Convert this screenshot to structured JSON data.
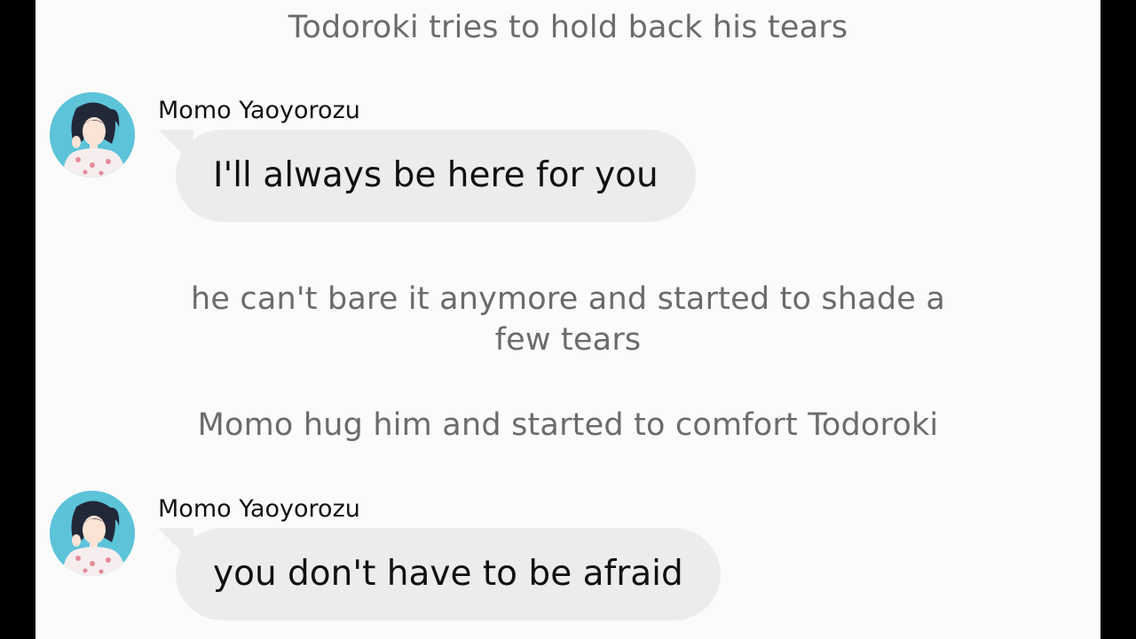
{
  "conversation": {
    "narration_1": "Todoroki tries to hold back his tears",
    "narration_2": "he can't bare it anymore and started to shade a few tears",
    "narration_3": "Momo hug him and started to comfort Todoroki",
    "messages": [
      {
        "sender": "Momo Yaoyorozu",
        "text": "I'll always be here for you",
        "avatar": "character-avatar"
      },
      {
        "sender": "Momo Yaoyorozu",
        "text": "you don't have to be afraid",
        "avatar": "character-avatar"
      }
    ]
  },
  "colors": {
    "background": "#fbfbfb",
    "bubble": "#ececec",
    "narration_text": "#6b6b6b",
    "avatar_background": "#5cc3d9",
    "letterbox": "#000000"
  }
}
